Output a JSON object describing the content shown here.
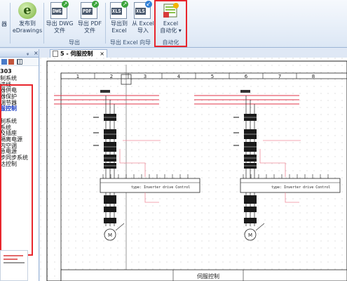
{
  "ribbon": {
    "partial_left": "器",
    "edrawings": "发布到\neDrawings",
    "export_dwg": "导出 DWG\n文件",
    "export_pdf": "导出 PDF\n文件",
    "export_group": "导出",
    "export_excel": "导出到\nExcel",
    "import_excel": "从 Excel\n导入",
    "excel_wizard_group": "导出 Excel 向导",
    "excel_auto": "Excel\n自动化 ▾",
    "excel_auto_group": "自动化",
    "dwg_tag": "DWG",
    "pdf_tag": "PDF",
    "xls_tag": "XLS"
  },
  "left_panel": {
    "pin": "ᵩ",
    "close": "×",
    "project": "303",
    "items": [
      "制系统",
      "进线",
      "器供电",
      "器保护",
      "调节器",
      "服控制",
      "",
      "制系统",
      "系统",
      "及插座",
      "隔离电源",
      "内空调",
      "急电源",
      "步同步系统",
      "达控制"
    ],
    "selected_index": 5
  },
  "document": {
    "tab_title": "5 - 伺服控制",
    "tab_close": "×",
    "columns": [
      "1",
      "2",
      "3",
      "4",
      "5",
      "6",
      "7",
      "8"
    ],
    "title_block": "伺服控制",
    "drive_label_left": "type: Inverter drive Control",
    "drive_label_right": "type: Inverter drive Control",
    "motor_label": "M"
  },
  "colors": {
    "highlight": "#e8262d",
    "wire_red": "#e0364a",
    "wire_pink": "#f08a9a"
  }
}
